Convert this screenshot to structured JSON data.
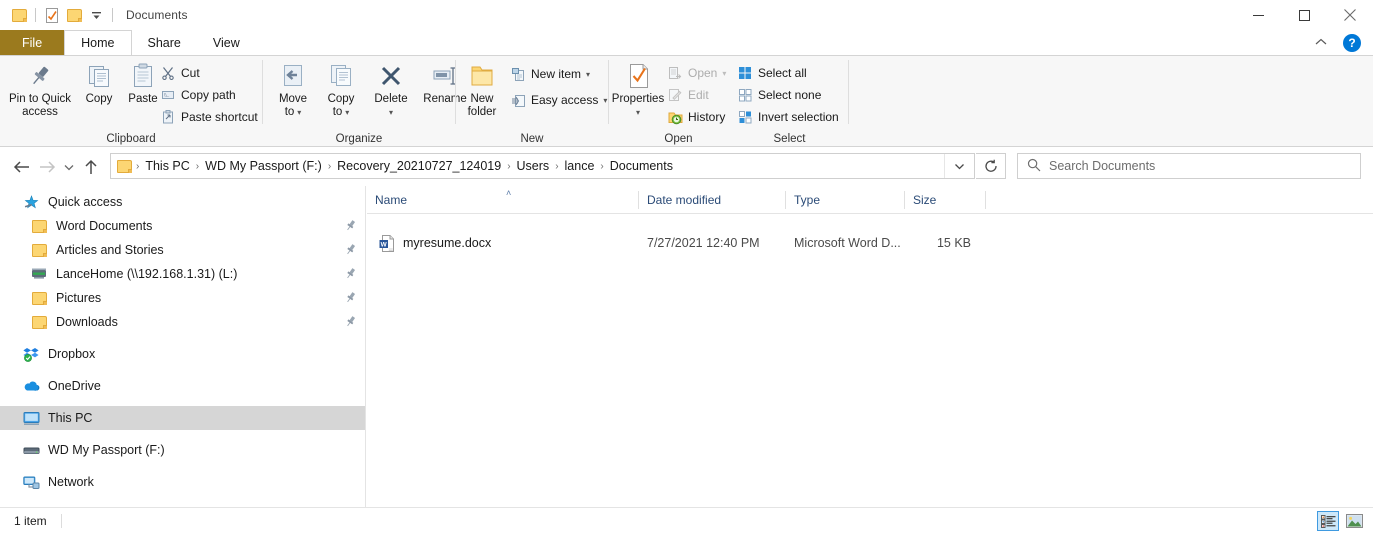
{
  "window": {
    "title": "Documents",
    "quick_access_icons": [
      "folder-icon",
      "properties-check-icon",
      "folder-icon",
      "dropdown-arrow-icon"
    ],
    "minimize_label": "Minimize",
    "maximize_label": "Maximize",
    "close_label": "Close",
    "collapse_ribbon_label": "Minimize the Ribbon",
    "help_label": "?"
  },
  "tabs": [
    {
      "label": "File",
      "active": false,
      "is_file": true
    },
    {
      "label": "Home",
      "active": true,
      "is_file": false
    },
    {
      "label": "Share",
      "active": false,
      "is_file": false
    },
    {
      "label": "View",
      "active": false,
      "is_file": false
    }
  ],
  "ribbon": {
    "groups": [
      {
        "name": "Clipboard",
        "label": "Clipboard",
        "big_buttons": [
          {
            "label": "Pin to Quick\naccess",
            "line1": "Pin to Quick",
            "line2": "access",
            "icon": "pin-icon"
          },
          {
            "label": "Copy",
            "line1": "Copy",
            "line2": "",
            "icon": "copy-icon"
          },
          {
            "label": "Paste",
            "line1": "Paste",
            "line2": "",
            "icon": "paste-icon"
          }
        ],
        "small_buttons": [
          {
            "label": "Cut",
            "icon": "scissors-icon",
            "disabled": false,
            "caret": false
          },
          {
            "label": "Copy path",
            "icon": "copy-path-icon",
            "disabled": false,
            "caret": false
          },
          {
            "label": "Paste shortcut",
            "icon": "paste-shortcut-icon",
            "disabled": false,
            "caret": false
          }
        ]
      },
      {
        "name": "Organize",
        "label": "Organize",
        "big_buttons": [
          {
            "label": "Move to",
            "line1": "Move",
            "line2": "to",
            "icon": "move-to-icon",
            "caret": true
          },
          {
            "label": "Copy to",
            "line1": "Copy",
            "line2": "to",
            "icon": "copy-to-icon",
            "caret": true
          },
          {
            "label": "Delete",
            "line1": "Delete",
            "line2": "",
            "icon": "delete-x-icon",
            "caret": true
          },
          {
            "label": "Rename",
            "line1": "Rename",
            "line2": "",
            "icon": "rename-icon",
            "caret": false
          }
        ]
      },
      {
        "name": "New",
        "label": "New",
        "big_buttons": [
          {
            "label": "New folder",
            "line1": "New",
            "line2": "folder",
            "icon": "new-folder-icon"
          }
        ],
        "small_buttons": [
          {
            "label": "New item",
            "icon": "new-item-icon",
            "disabled": false,
            "caret": true
          },
          {
            "label": "Easy access",
            "icon": "easy-access-icon",
            "disabled": false,
            "caret": true
          }
        ]
      },
      {
        "name": "Open",
        "label": "Open",
        "big_buttons": [
          {
            "label": "Properties",
            "line1": "Properties",
            "line2": "",
            "icon": "properties-icon",
            "caret": true
          }
        ],
        "small_buttons": [
          {
            "label": "Open",
            "icon": "open-icon",
            "disabled": true,
            "caret": true
          },
          {
            "label": "Edit",
            "icon": "edit-icon",
            "disabled": true,
            "caret": false
          },
          {
            "label": "History",
            "icon": "history-icon",
            "disabled": false,
            "caret": false
          }
        ]
      },
      {
        "name": "Select",
        "label": "Select",
        "small_buttons": [
          {
            "label": "Select all",
            "icon": "select-all-icon",
            "disabled": false,
            "caret": false
          },
          {
            "label": "Select none",
            "icon": "select-none-icon",
            "disabled": false,
            "caret": false
          },
          {
            "label": "Invert selection",
            "icon": "invert-selection-icon",
            "disabled": false,
            "caret": false
          }
        ]
      }
    ]
  },
  "navigation": {
    "back_label": "Back",
    "forward_label": "Forward",
    "recent_label": "Recent locations",
    "up_label": "Up",
    "breadcrumbs": [
      "This PC",
      "WD My Passport (F:)",
      "Recovery_20210727_124019",
      "Users",
      "lance",
      "Documents"
    ],
    "separator": "›",
    "dropdown_label": "Previous locations",
    "refresh_label": "Refresh"
  },
  "search": {
    "placeholder": "Search Documents",
    "value": "",
    "icon": "search-icon"
  },
  "sidebar": {
    "items": [
      {
        "label": "Quick access",
        "icon": "quick-access-star-icon",
        "level": "root",
        "pinned": false,
        "selected": false
      },
      {
        "label": "Word Documents",
        "icon": "folder-icon",
        "level": "child",
        "pinned": true,
        "selected": false
      },
      {
        "label": "Articles and Stories",
        "icon": "folder-icon",
        "level": "child",
        "pinned": true,
        "selected": false
      },
      {
        "label": "LanceHome (\\\\192.168.1.31) (L:)",
        "icon": "network-drive-icon",
        "level": "child",
        "pinned": true,
        "selected": false
      },
      {
        "label": "Pictures",
        "icon": "folder-icon",
        "level": "child",
        "pinned": true,
        "selected": false
      },
      {
        "label": "Downloads",
        "icon": "folder-icon",
        "level": "child",
        "pinned": true,
        "selected": false
      },
      {
        "label": "Dropbox",
        "icon": "dropbox-icon",
        "level": "root",
        "pinned": false,
        "selected": false
      },
      {
        "label": "OneDrive",
        "icon": "onedrive-cloud-icon",
        "level": "root",
        "pinned": false,
        "selected": false
      },
      {
        "label": "This PC",
        "icon": "this-pc-monitor-icon",
        "level": "root",
        "pinned": false,
        "selected": true
      },
      {
        "label": "WD My Passport (F:)",
        "icon": "external-drive-icon",
        "level": "root",
        "pinned": false,
        "selected": false
      },
      {
        "label": "Network",
        "icon": "network-icon",
        "level": "root",
        "pinned": false,
        "selected": false
      }
    ]
  },
  "filelist": {
    "columns": [
      {
        "label": "Name",
        "sorted": true,
        "sort_dir": "asc"
      },
      {
        "label": "Date modified",
        "sorted": false,
        "sort_dir": ""
      },
      {
        "label": "Type",
        "sorted": false,
        "sort_dir": ""
      },
      {
        "label": "Size",
        "sorted": false,
        "sort_dir": ""
      }
    ],
    "sort_glyph": "˄",
    "rows": [
      {
        "name": "myresume.docx",
        "date_modified": "7/27/2021 12:40 PM",
        "type": "Microsoft Word D...",
        "size": "15 KB",
        "icon": "word-document-icon"
      }
    ]
  },
  "statusbar": {
    "item_count": "1 item",
    "view_buttons": [
      {
        "name": "details-view",
        "icon": "details-view-icon",
        "active": true
      },
      {
        "name": "large-icons-view",
        "icon": "large-icons-view-icon",
        "active": false
      }
    ]
  }
}
